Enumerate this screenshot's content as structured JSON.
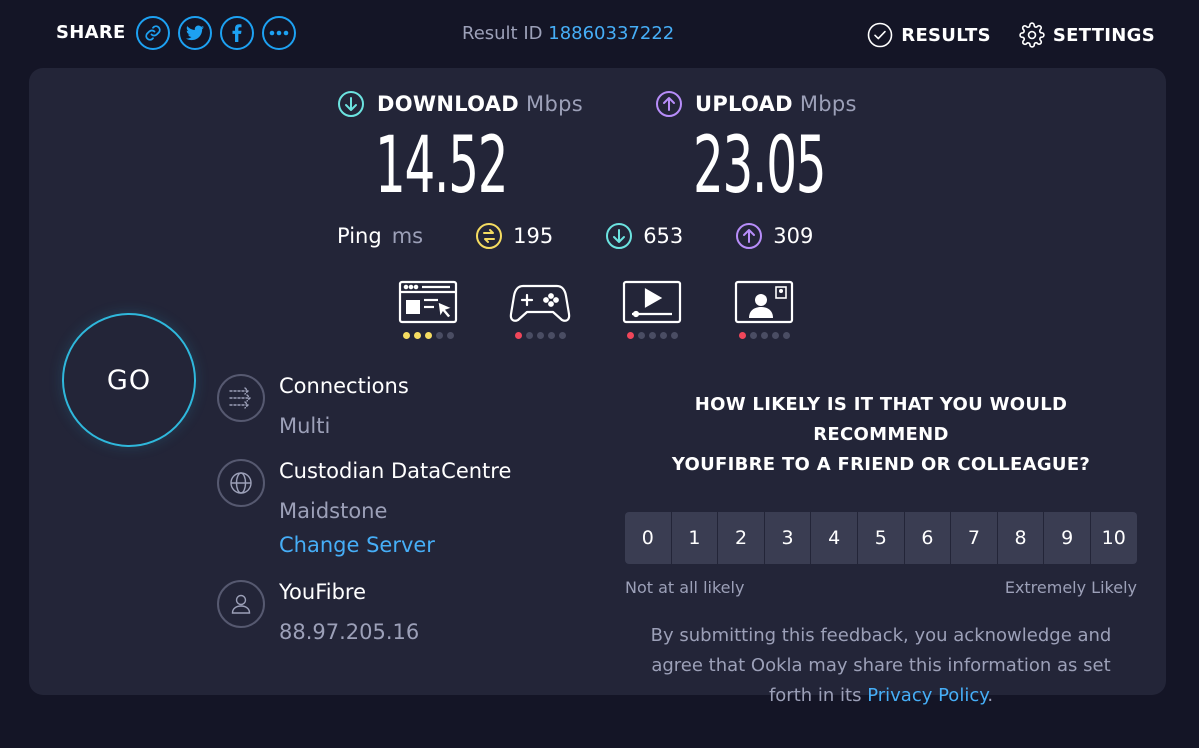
{
  "header": {
    "share_label": "SHARE",
    "share_buttons": [
      "link-icon",
      "twitter-icon",
      "facebook-icon",
      "more-icon"
    ],
    "result_label": "Result ID",
    "result_id": "18860337222",
    "results_label": "RESULTS",
    "settings_label": "SETTINGS"
  },
  "speeds": {
    "download": {
      "label": "DOWNLOAD",
      "unit": "Mbps",
      "value": "14.52"
    },
    "upload": {
      "label": "UPLOAD",
      "unit": "Mbps",
      "value": "23.05"
    }
  },
  "ping": {
    "label": "Ping",
    "unit": "ms",
    "idle": "195",
    "download": "653",
    "upload": "309"
  },
  "quality": [
    {
      "icon": "browsing-icon",
      "rating": 3,
      "color": "#f5dc61"
    },
    {
      "icon": "gaming-icon",
      "rating": 1,
      "color": "#f0465a"
    },
    {
      "icon": "streaming-icon",
      "rating": 1,
      "color": "#f0465a"
    },
    {
      "icon": "video-call-icon",
      "rating": 1,
      "color": "#f0465a"
    }
  ],
  "go_label": "GO",
  "connections": {
    "title": "Connections",
    "value": "Multi"
  },
  "server": {
    "name": "Custodian DataCentre",
    "location": "Maidstone",
    "change_label": "Change Server"
  },
  "isp": {
    "name": "YouFibre",
    "ip": "88.97.205.16"
  },
  "survey": {
    "question_line1": "HOW LIKELY IS IT THAT YOU WOULD RECOMMEND",
    "question_line2": "YOUFIBRE TO A FRIEND OR COLLEAGUE?",
    "scale": [
      "0",
      "1",
      "2",
      "3",
      "4",
      "5",
      "6",
      "7",
      "8",
      "9",
      "10"
    ],
    "low_label": "Not at all likely",
    "high_label": "Extremely Likely",
    "disclaimer_line1": "By submitting this feedback, you acknowledge and",
    "disclaimer_line2": "agree that Ookla may share this information as set",
    "disclaimer_line3_prefix": "forth in its",
    "privacy_link": "Privacy Policy",
    "disclaimer_line3_suffix": "."
  },
  "colors": {
    "background": "#141526",
    "panel": "#232538",
    "accent_blue": "#46aef7",
    "download": "#6ce3e0",
    "upload": "#b78df9",
    "idle_ping": "#f5dc61",
    "go_ring": "#2fb8dc"
  }
}
